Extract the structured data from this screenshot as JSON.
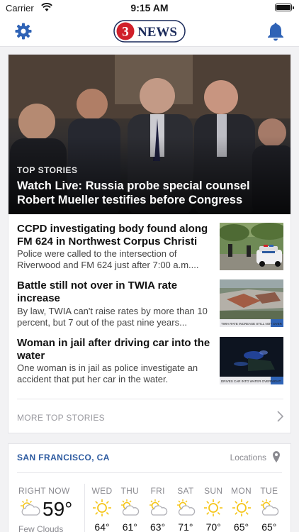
{
  "status_bar": {
    "carrier": "Carrier",
    "time": "9:15 AM"
  },
  "header": {
    "logo_text": "NEWS",
    "logo_number": "3"
  },
  "top_stories": {
    "hero": {
      "kicker": "TOP STORIES",
      "headline": "Watch Live: Russia probe special counsel Robert Mueller testifies before Congress"
    },
    "stories": [
      {
        "title": "CCPD investigating body found along FM 624 in Northwest Corpus Christi",
        "summary": "Police were called to the intersection of Riverwood and FM 624 just after 7:00 a.m...."
      },
      {
        "title": "Battle still not over in TWIA rate increase",
        "summary": "By law, TWIA can't raise rates by more than 10 percent, but 7 out of the past nine years..."
      },
      {
        "title": "Woman in jail after driving car into the water",
        "summary": "One woman is in jail as police investigate an accident that put her car in the water."
      }
    ],
    "thumb_captions": [
      "",
      "TWIA RATE INCREASE STILL NOT OVER",
      "DRIVES CAR INTO WATER OVERNIGHT"
    ],
    "more_label": "MORE TOP STORIES"
  },
  "weather": {
    "location": "SAN FRANCISCO, CA",
    "locations_label": "Locations",
    "now_label": "RIGHT NOW",
    "now_temp": "59°",
    "now_desc": "Few Clouds",
    "now_icon": "partly-cloudy-icon",
    "forecast": [
      {
        "day": "WED",
        "temp": "64°",
        "icon": "sun-icon"
      },
      {
        "day": "THU",
        "temp": "61°",
        "icon": "partly-cloudy-icon"
      },
      {
        "day": "FRI",
        "temp": "63°",
        "icon": "partly-cloudy-icon"
      },
      {
        "day": "SAT",
        "temp": "71°",
        "icon": "partly-cloudy-icon"
      },
      {
        "day": "SUN",
        "temp": "70°",
        "icon": "sun-icon"
      },
      {
        "day": "MON",
        "temp": "65°",
        "icon": "sun-icon"
      },
      {
        "day": "TUE",
        "temp": "65°",
        "icon": "partly-cloudy-icon"
      }
    ]
  },
  "colors": {
    "accent": "#2c5aa0",
    "logo_red": "#d0202a",
    "icon_blue": "#2f63b6",
    "sun": "#f5c518"
  }
}
